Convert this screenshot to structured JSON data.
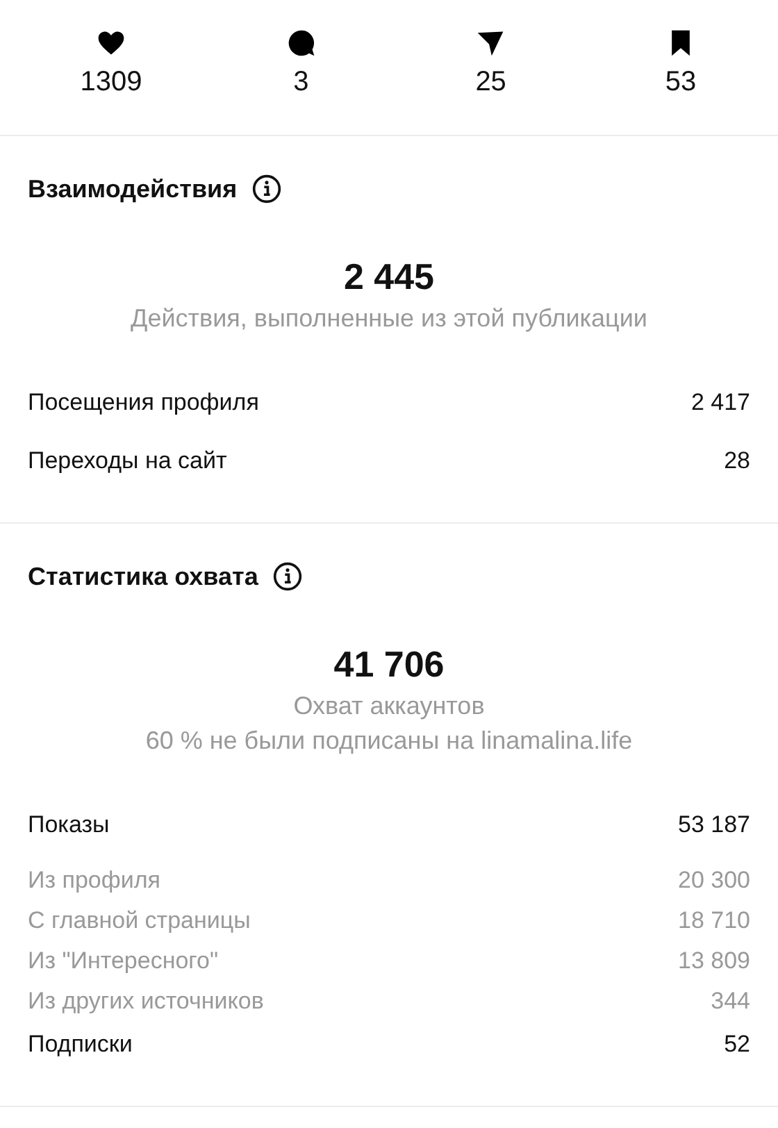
{
  "stats": [
    {
      "kind": "heart",
      "count": "1309"
    },
    {
      "kind": "comment",
      "count": "3"
    },
    {
      "kind": "share",
      "count": "25"
    },
    {
      "kind": "save",
      "count": "53"
    }
  ],
  "sections": [
    {
      "title": "Взаимодействия",
      "total": "2 445",
      "captions": [
        "Действия, выполненные из этой публикации"
      ],
      "rows": [
        {
          "kind": "main",
          "label": "Посещения профиля",
          "value": "2 417"
        },
        {
          "kind": "main",
          "label": "Переходы на сайт",
          "value": "28"
        }
      ]
    },
    {
      "title": "Статистика охвата",
      "total": "41 706",
      "captions": [
        "Охват аккаунтов",
        "60 % не были подписаны на linamalina.life"
      ],
      "rows": [
        {
          "kind": "main",
          "label": "Показы",
          "value": "53 187"
        },
        {
          "kind": "sub",
          "label": "Из профиля",
          "value": "20 300"
        },
        {
          "kind": "sub",
          "label": "С главной страницы",
          "value": "18 710"
        },
        {
          "kind": "sub",
          "label": "Из \"Интересного\"",
          "value": "13 809"
        },
        {
          "kind": "sub",
          "label": "Из других источников",
          "value": "344"
        },
        {
          "kind": "main",
          "label": "Подписки",
          "value": "52"
        }
      ]
    }
  ]
}
